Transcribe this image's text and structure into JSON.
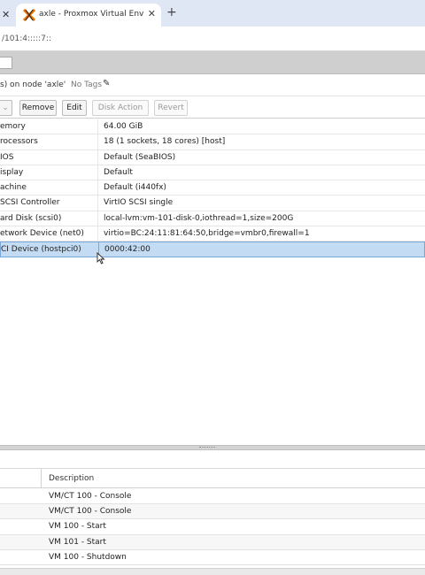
{
  "browser": {
    "prev_tab_close": "✕",
    "active_tab_title": "axle - Proxmox Virtual Environment",
    "active_tab_close": "✕",
    "new_tab": "+",
    "url": "/101:4:::::7::"
  },
  "node_header": {
    "title": "s) on node 'axle'",
    "tags": "No Tags"
  },
  "toolbar": {
    "remove": "Remove",
    "edit": "Edit",
    "disk_action": "Disk Action",
    "revert": "Revert"
  },
  "hardware": [
    {
      "key": "emory",
      "value": "64.00 GiB"
    },
    {
      "key": "rocessors",
      "value": "18 (1 sockets, 18 cores) [host]"
    },
    {
      "key": "IOS",
      "value": "Default (SeaBIOS)"
    },
    {
      "key": "isplay",
      "value": "Default"
    },
    {
      "key": "achine",
      "value": "Default (i440fx)"
    },
    {
      "key": "SCSI Controller",
      "value": "VirtIO SCSI single"
    },
    {
      "key": "ard Disk (scsi0)",
      "value": "local-lvm:vm-101-disk-0,iothread=1,size=200G"
    },
    {
      "key": "etwork Device (net0)",
      "value": "virtio=BC:24:11:81:64:50,bridge=vmbr0,firewall=1"
    },
    {
      "key": "CI Device (hostpci0)",
      "value": "0000:42:00",
      "selected": true
    }
  ],
  "tasks": {
    "description_header": "Description",
    "rows": [
      "VM/CT 100 - Console",
      "VM/CT 100 - Console",
      "VM 100 - Start",
      "VM 101 - Start",
      "VM 100 - Shutdown"
    ]
  },
  "colors": {
    "selected_row": "#c4dcf3",
    "selected_border": "#7aa7d6",
    "tabstrip": "#dfe7f5"
  }
}
